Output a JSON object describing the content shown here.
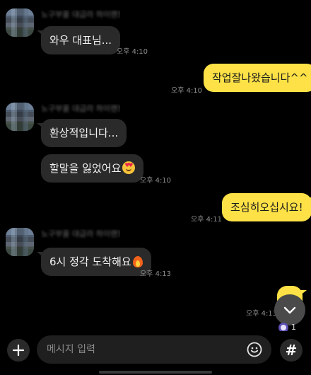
{
  "chat": {
    "groups": [
      {
        "sender_name": "노구부울 대급라 하이랜드"
      },
      {
        "sender_name": "노구부울 대급라 하이랜드"
      },
      {
        "sender_name": "노구부울 대급라 하이랜드"
      }
    ],
    "messages": [
      {
        "direction": "in",
        "text": "와우 대표님...",
        "time": "오후 4:10"
      },
      {
        "direction": "out",
        "text": "작업잘나왔습니다^^",
        "time": "오후 4:10"
      },
      {
        "direction": "in",
        "text": "환상적입니다...",
        "time": ""
      },
      {
        "direction": "in",
        "text": "할말을 잃었어요",
        "emoji": "smiling-face-with-heart-eyes",
        "time": "오후 4:10"
      },
      {
        "direction": "out",
        "text": "조심히오십시요!",
        "time": "오후 4:11"
      },
      {
        "direction": "in",
        "text": "6시 정각 도착해요",
        "emoji": "fire",
        "time": "오후 4:13"
      },
      {
        "direction": "out",
        "text": "",
        "time": "오후 4:13"
      }
    ],
    "reaction": {
      "icon": "reaction-icon",
      "count": "1"
    }
  },
  "composer": {
    "placeholder": "메시지 입력",
    "icons": {
      "attach": "plus-icon",
      "emoji": "smiley-icon",
      "hashtag": "hash-icon",
      "scroll": "chevron-down-icon"
    },
    "hash_symbol": "#"
  },
  "colors": {
    "background": "#000000",
    "incoming_bubble": "#2a2a2a",
    "outgoing_bubble": "#fde146",
    "timestamp": "#8e8e8e"
  }
}
